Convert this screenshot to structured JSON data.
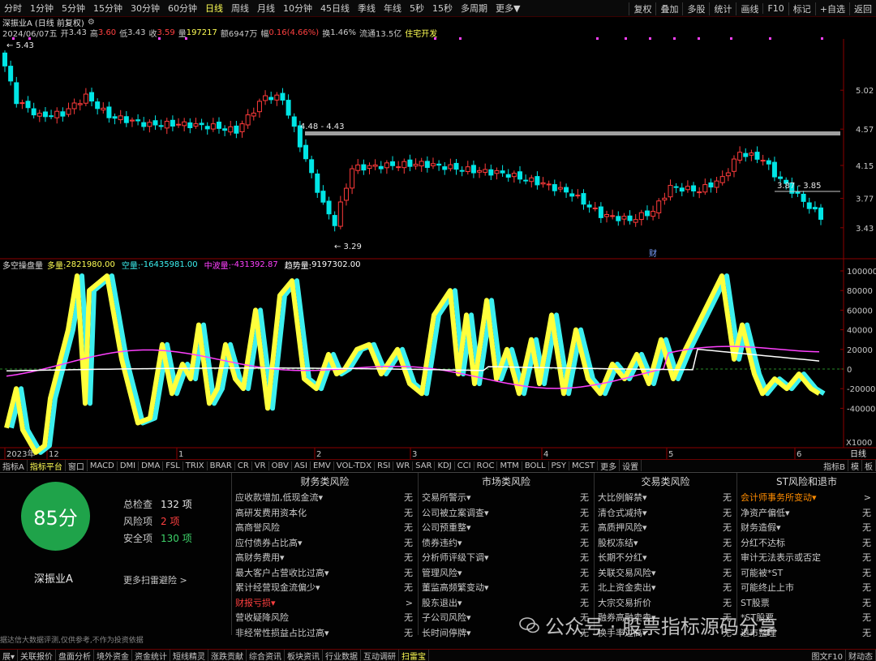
{
  "topbar": {
    "periods": [
      "分时",
      "1分钟",
      "5分钟",
      "15分钟",
      "30分钟",
      "60分钟",
      "日线",
      "周线",
      "月线",
      "10分钟",
      "45日线",
      "季线",
      "年线",
      "5秒",
      "15秒",
      "多周期",
      "更多▼"
    ],
    "active": "日线",
    "right": [
      "复权",
      "叠加",
      "多股",
      "统计",
      "画线",
      "F10",
      "标记",
      "+自选",
      "返回"
    ]
  },
  "info": {
    "name": "深振业A",
    "mode": "(日线 前复权)",
    "date": "2024/06/07五",
    "open_l": "开",
    "open": "3.43",
    "high_l": "高",
    "high": "3.60",
    "low_l": "低",
    "low": "3.43",
    "close_l": "收",
    "close": "3.59",
    "vol_l": "量",
    "vol": "197217",
    "amt_l": "额",
    "amt": "6947万",
    "chg_l": "幅",
    "chg": "0.16(4.66%)",
    "turn_l": "换",
    "turn": "1.46%",
    "float_l": "流通",
    "float": "13.5亿",
    "industry": "住宅开发"
  },
  "price_axis": [
    "5.02",
    "4.57",
    "4.15",
    "3.77",
    "3.43"
  ],
  "annotations": {
    "max": "5.43",
    "min": "3.29",
    "zone1": "4.48 - 4.43",
    "zone2": "3.87 - 3.85",
    "cai": "财"
  },
  "indicator": {
    "name": "多空操盘量",
    "duo_l": "多量:",
    "duo": "2821980.00",
    "kong_l": "空量:",
    "kong": "-16435981.00",
    "zhong_l": "中波量:",
    "zhong": "-431392.87",
    "qushi_l": "趋势量:",
    "qushi": "9197302.00"
  },
  "ind_axis": [
    "100000",
    "80000",
    "60000",
    "40000",
    "20000",
    "0",
    "-20000",
    "-40000"
  ],
  "ind_unit": "X1000",
  "time_axis": [
    "2023年",
    "12",
    "1",
    "2",
    "3",
    "4",
    "5",
    "6"
  ],
  "period_label": "日线",
  "ind_tabs": [
    "指标A",
    "指标平台",
    "窗口",
    "MACD",
    "DMI",
    "DMA",
    "FSL",
    "TRIX",
    "BRAR",
    "CR",
    "VR",
    "OBV",
    "ASI",
    "EMV",
    "VOL-TDX",
    "RSI",
    "WR",
    "SAR",
    "KDJ",
    "CCI",
    "ROC",
    "MTM",
    "BOLL",
    "PSY",
    "MCST",
    "更多",
    "设置"
  ],
  "ind_tabs_active": "指标平台",
  "ind_tabs_right": [
    "指标B",
    "模",
    "板"
  ],
  "risk": {
    "score": "85分",
    "stock": "深振业A",
    "total_l": "总检查",
    "total": "132 项",
    "risk_l": "风险项",
    "risk_n": "2 项",
    "safe_l": "安全项",
    "safe": "130 项",
    "more": "更多扫雷避险 >",
    "disclaimer": "据达信大数据评测,仅供参考,不作为投资依据",
    "cols": [
      {
        "title": "财务类风险",
        "items": [
          [
            "应收款增加,低现金流▾",
            "无",
            ""
          ],
          [
            "高研发费用资本化",
            "无",
            ""
          ],
          [
            "高商誉风险",
            "无",
            ""
          ],
          [
            "应付债券占比高▾",
            "无",
            ""
          ],
          [
            "高财务费用▾",
            "无",
            ""
          ],
          [
            "最大客户占营收比过高▾",
            "无",
            ""
          ],
          [
            "累计经营现金流偏少▾",
            "无",
            ""
          ],
          [
            "财报亏损▾",
            ">",
            "red"
          ],
          [
            "营收疑降风险",
            "无",
            ""
          ],
          [
            "非经常性损益占比过高▾",
            "无",
            ""
          ]
        ]
      },
      {
        "title": "市场类风险",
        "items": [
          [
            "交易所警示▾",
            "无",
            ""
          ],
          [
            "公司被立案调查▾",
            "无",
            ""
          ],
          [
            "公司预重整▾",
            "无",
            ""
          ],
          [
            "债券违约▾",
            "无",
            ""
          ],
          [
            "分析师评级下调▾",
            "无",
            ""
          ],
          [
            "管理风险▾",
            "无",
            ""
          ],
          [
            "董监高频繁变动▾",
            "无",
            ""
          ],
          [
            "股东退出▾",
            "无",
            ""
          ],
          [
            "子公司风险▾",
            "无",
            ""
          ],
          [
            "长时间停牌▾",
            "无",
            ""
          ]
        ]
      },
      {
        "title": "交易类风险",
        "items": [
          [
            "大比例解禁▾",
            "无",
            ""
          ],
          [
            "清仓式减持▾",
            "无",
            ""
          ],
          [
            "高质押风险▾",
            "无",
            ""
          ],
          [
            "股权冻结▾",
            "无",
            ""
          ],
          [
            "长期不分红▾",
            "无",
            ""
          ],
          [
            "关联交易风险▾",
            "无",
            ""
          ],
          [
            "北上资金卖出▾",
            "无",
            ""
          ],
          [
            "大宗交易折价",
            "无",
            ""
          ],
          [
            "融券高融卖卖▾",
            "无",
            ""
          ],
          [
            "换手率过高▾",
            "无",
            ""
          ]
        ]
      },
      {
        "title": "ST风险和退市",
        "items": [
          [
            "会计师事务所变动▾",
            ">",
            "orange"
          ],
          [
            "净资产偏低▾",
            "无",
            ""
          ],
          [
            "财务造假▾",
            "无",
            ""
          ],
          [
            "分红不达标",
            "无",
            ""
          ],
          [
            "审计无法表示或否定",
            "无",
            ""
          ],
          [
            "可能被*ST",
            "无",
            ""
          ],
          [
            "可能终止上市",
            "无",
            ""
          ],
          [
            "ST股票",
            "无",
            ""
          ],
          [
            "*ST股票",
            "无",
            ""
          ],
          [
            "退市整理",
            "无",
            ""
          ]
        ]
      }
    ]
  },
  "watermark": "公众号 · 股票指标源码分享",
  "bottombar": [
    "展▾",
    "关联报价",
    "盘面分析",
    "境外资金",
    "资金统计",
    "短线精灵",
    "涨跌贡献",
    "综合资讯",
    "板块资讯",
    "行业数据",
    "互动调研",
    "扫雷宝"
  ],
  "bottom_active": "扫雷宝",
  "bottom_right": [
    "图文F10",
    "财动态"
  ],
  "colors": {
    "up": "#ff3b3b",
    "down": "#00e5e5",
    "duo": "#ffff3c",
    "kong": "#3cf0f0",
    "mid": "#ff40ff",
    "trend": "#ffffff"
  }
}
